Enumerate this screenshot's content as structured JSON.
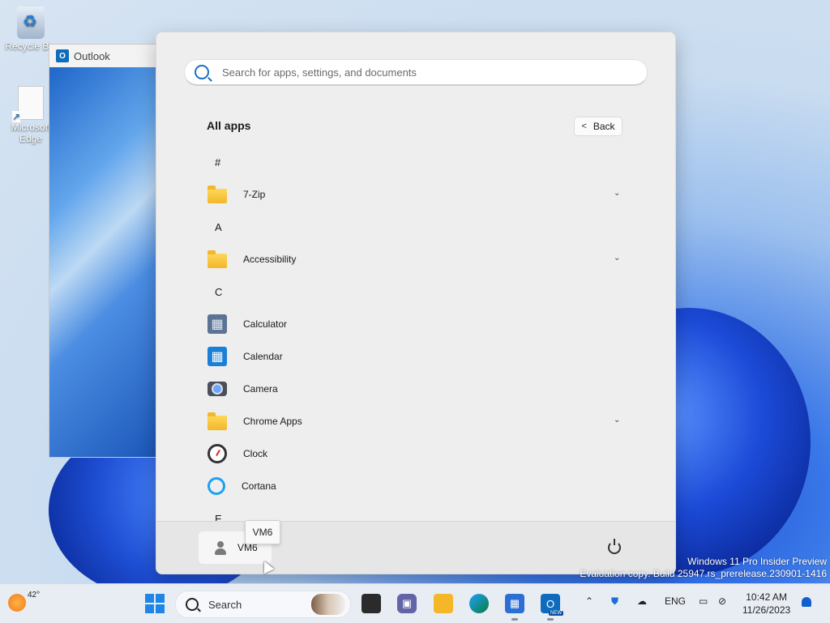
{
  "desktop": {
    "icons": [
      {
        "label": "Recycle Bin",
        "icon": "recycle-bin-icon"
      },
      {
        "label": "Microsoft Edge",
        "icon": "shortcut-icon"
      }
    ],
    "watermark_line1": "Windows 11 Pro Insider Preview",
    "watermark_line2": "Evaluation copy. Build 25947.rs_prerelease.230901-1416"
  },
  "outlook_window": {
    "title": "Outlook"
  },
  "start_menu": {
    "search_placeholder": "Search for apps, settings, and documents",
    "section_title": "All apps",
    "back_label": "Back",
    "groups": [
      {
        "letter": "#",
        "apps": [
          {
            "name": "7-Zip",
            "icon": "folder-icon",
            "expandable": true
          }
        ]
      },
      {
        "letter": "A",
        "apps": [
          {
            "name": "Accessibility",
            "icon": "folder-icon",
            "expandable": true
          }
        ]
      },
      {
        "letter": "C",
        "apps": [
          {
            "name": "Calculator",
            "icon": "calculator-icon",
            "expandable": false
          },
          {
            "name": "Calendar",
            "icon": "calendar-icon",
            "expandable": false
          },
          {
            "name": "Camera",
            "icon": "camera-icon",
            "expandable": false
          },
          {
            "name": "Chrome Apps",
            "icon": "folder-icon",
            "expandable": true
          },
          {
            "name": "Clock",
            "icon": "clock-icon",
            "expandable": false
          },
          {
            "name": "Cortana",
            "icon": "cortana-icon",
            "expandable": false
          }
        ]
      },
      {
        "letter": "E",
        "apps": []
      }
    ],
    "user_name": "VM6",
    "tooltip": "VM6"
  },
  "taskbar": {
    "weather_temp": "42°",
    "search_label": "Search",
    "language": "ENG",
    "time": "10:42 AM",
    "date": "11/26/2023"
  }
}
